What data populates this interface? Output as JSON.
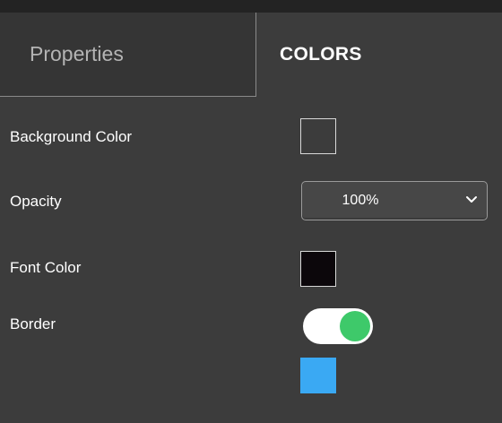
{
  "tabs": [
    {
      "label": "Properties",
      "active": false
    },
    {
      "label": "COLORS",
      "active": true
    }
  ],
  "fields": {
    "background_color": {
      "label": "Background Color",
      "value": "#00000000"
    },
    "opacity": {
      "label": "Opacity",
      "value": "100%"
    },
    "font_color": {
      "label": "Font Color",
      "value": "#0c070b"
    },
    "border": {
      "label": "Border",
      "enabled": true,
      "color": "#3aa9f3"
    }
  },
  "colors": {
    "panel_background": "#3c3c3c",
    "toggle_on": "#3ec96a"
  },
  "icons": {
    "select_arrow": "chevron-down-icon"
  }
}
